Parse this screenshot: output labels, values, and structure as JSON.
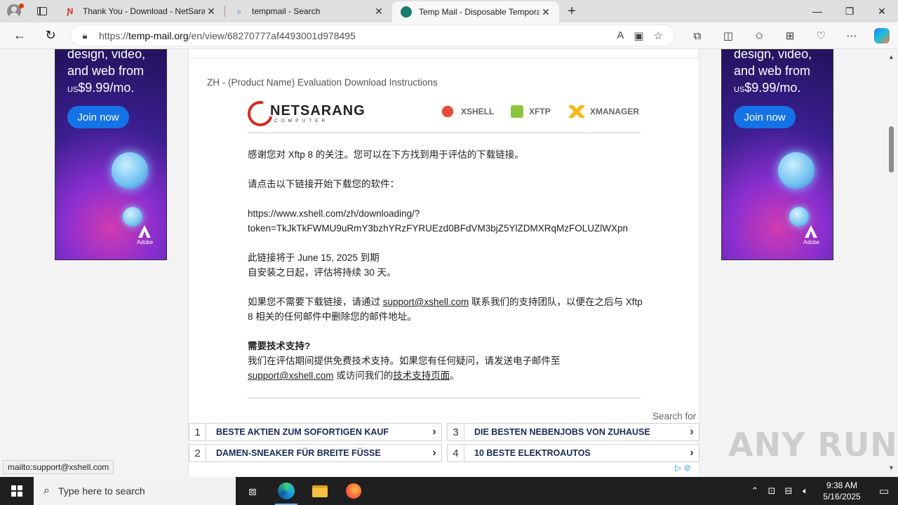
{
  "tabs": [
    {
      "title": "Thank You - Download - NetSarang",
      "favicon": "netsarang-icon",
      "active": false
    },
    {
      "title": "tempmail - Search",
      "favicon": "search-icon",
      "active": false
    },
    {
      "title": "Temp Mail - Disposable Temporary",
      "favicon": "tempmail-icon",
      "active": true
    }
  ],
  "address": {
    "url_prefix": "https://",
    "url_domain": "temp-mail.org",
    "url_path": "/en/view/68270777af4493001d978495"
  },
  "ads": {
    "headline": "design, video, and web from",
    "price_prefix": "US",
    "price": "$9.99/mo.",
    "button": "Join now",
    "brand": "Adobe"
  },
  "email": {
    "subject": "ZH - (Product Name) Evaluation Download Instructions",
    "logo": {
      "brand": "NETSARANG",
      "brand_sub": "COMPUTER",
      "products": [
        "XSHELL",
        "XFTP",
        "XMANAGER"
      ]
    },
    "p1": "感谢您对 Xftp 8 的关注。您可以在下方找到用于评估的下载链接。",
    "p2": "请点击以下链接开始下载您的软件：",
    "link_line1": "https://www.xshell.com/zh/downloading/?",
    "link_line2": "token=TkJkTkFWMU9uRmY3bzhYRzFYRUEzd0BFdVM3bjZ5YlZDMXRqMzFOLUZlWXpn",
    "expire_line1": "此链接将于 June 15, 2025 到期",
    "expire_line2": "自安装之日起，评估将持续 30 天。",
    "p4_before": "如果您不需要下载链接，请通过 ",
    "p4_link": "support@xshell.com",
    "p4_after": " 联系我们的支持团队，以便在之后与 Xftp 8 相关的任何邮件中删除您的邮件地址。",
    "support_heading": "需要技术支持?",
    "support_line": "我们在评估期间提供免费技术支持。如果您有任何疑问，请发送电子邮件至",
    "support_email": "support@xshell.com",
    "support_mid": " 或访问我们的",
    "support_page": "技术支持页面",
    "support_end": "。"
  },
  "search_ads": {
    "label": "Search for",
    "items": [
      {
        "num": "1",
        "text": "BESTE AKTIEN ZUM SOFORTIGEN KAUF"
      },
      {
        "num": "2",
        "text": "DAMEN-SNEAKER FÜR BREITE FÜSSE"
      },
      {
        "num": "3",
        "text": "DIE BESTEN NEBENJOBS VON ZUHAUSE"
      },
      {
        "num": "4",
        "text": "10 BESTE ELEKTROAUTOS"
      }
    ]
  },
  "status_url": "mailto:support@xshell.com",
  "watermark": "ANY RUN",
  "taskbar": {
    "search_placeholder": "Type here to search",
    "time": "9:38 AM",
    "date": "5/16/2025"
  }
}
